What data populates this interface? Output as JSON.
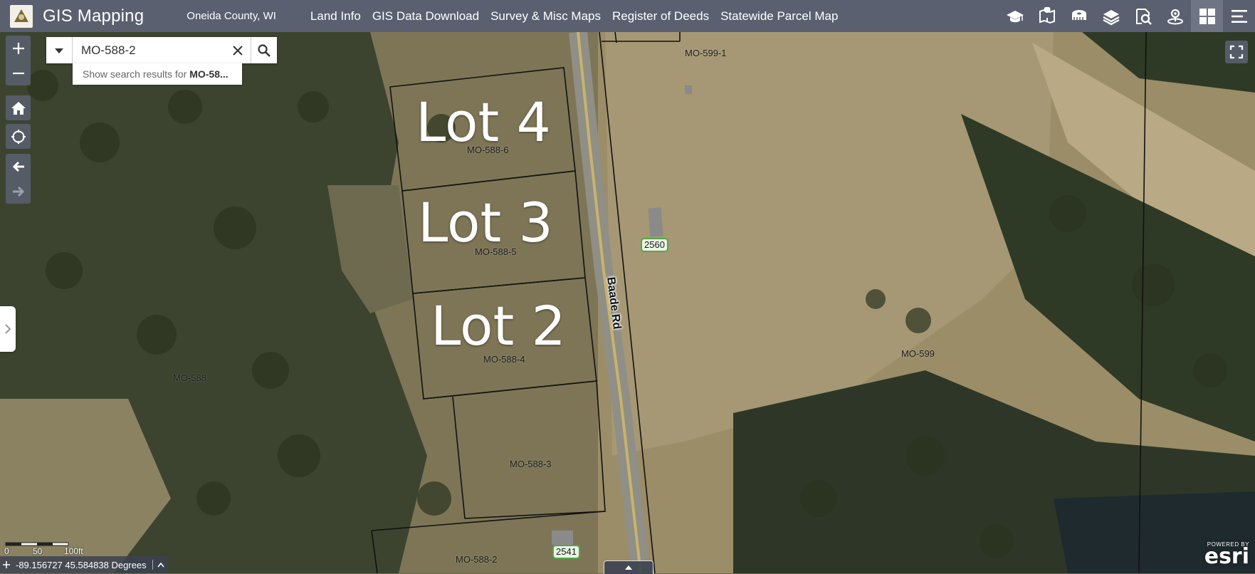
{
  "header": {
    "app_title": "GIS Mapping",
    "subtitle": "Oneida County, WI",
    "nav": [
      "Land Info",
      "GIS Data Download",
      "Survey & Misc Maps",
      "Register of Deeds",
      "Statewide Parcel Map"
    ],
    "widgets": [
      "graduation-cap-icon",
      "map-pin-icon",
      "measure-icon",
      "layers-icon",
      "query-icon",
      "locate-pin-icon",
      "grid-icon",
      "menu-icon"
    ]
  },
  "search": {
    "value": "MO-588-2",
    "suggestion_prefix": "Show search results for ",
    "suggestion_term": "MO-58..."
  },
  "map": {
    "lots": [
      "Lot 4",
      "Lot 3",
      "Lot 2"
    ],
    "parcels": [
      "MO-599-1",
      "MO-588-6",
      "MO-588-5",
      "MO-588-4",
      "MO-588-3",
      "MO-588",
      "MO-599",
      "MO-588-2"
    ],
    "addresses": [
      "2560",
      "2541"
    ],
    "road": "Baade Rd"
  },
  "scalebar": {
    "labels": [
      "0",
      "50",
      "100ft"
    ]
  },
  "coords": "-89.156727 45.584838 Degrees",
  "attribution": {
    "powered_by": "POWERED BY",
    "brand": "esri"
  },
  "colors": {
    "header": "#5a6070",
    "road": "#c9b26c",
    "parcel_line": "#111111",
    "address_border": "#52a84a"
  }
}
